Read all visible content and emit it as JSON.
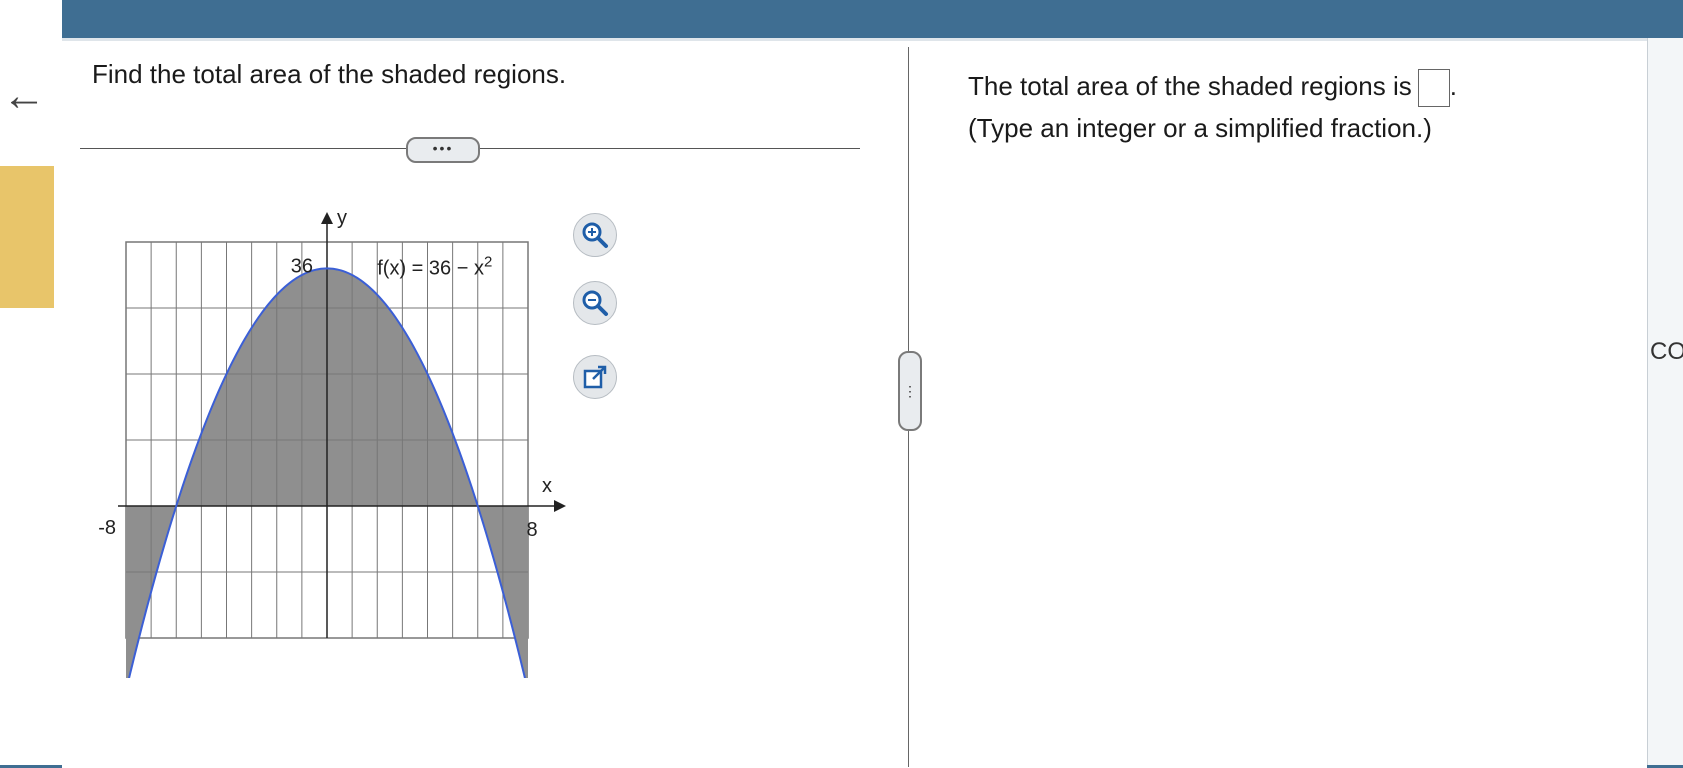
{
  "question": {
    "prompt": "Find the total area of the shaded regions.",
    "more_label": "•••"
  },
  "answer": {
    "prefix": "The total area of the shaded regions is",
    "suffix": ".",
    "hint": "(Type an integer or a simplified fraction.)",
    "value": ""
  },
  "tools": {
    "zoom_in": "zoom-in-icon",
    "zoom_out": "zoom-out-icon",
    "popout": "popout-icon"
  },
  "right_edge_text": "CO",
  "chart_data": {
    "type": "line",
    "function_label": "f(x) = 36 − x",
    "function_exponent": "2",
    "xlabel": "x",
    "ylabel": "y",
    "x_tick_labels": [
      "-8",
      "8"
    ],
    "y_tick_labels": [
      "36"
    ],
    "xlim": [
      -8,
      8
    ],
    "ylim": [
      -20,
      40
    ],
    "grid": true,
    "shaded_regions": [
      {
        "from": -8,
        "to": -6
      },
      {
        "from": -6,
        "to": 6
      },
      {
        "from": 6,
        "to": 8
      }
    ],
    "colors": {
      "curve": "#3b5fd6",
      "shade": "#8f8f8f",
      "grid": "#777777"
    }
  }
}
